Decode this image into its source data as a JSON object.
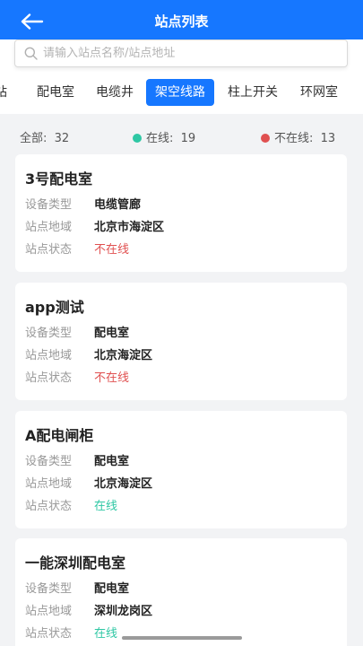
{
  "header": {
    "title": "站点列表"
  },
  "search": {
    "placeholder": "请输入站点名称/站点地址"
  },
  "tabs": [
    {
      "label": "站"
    },
    {
      "label": "配电室"
    },
    {
      "label": "电缆井"
    },
    {
      "label": "架空线路",
      "active": true
    },
    {
      "label": "柱上开关"
    },
    {
      "label": "环网室"
    }
  ],
  "summary": {
    "total_label": "全部:",
    "total": "32",
    "online_label": "在线:",
    "online": "19",
    "offline_label": "不在线:",
    "offline": "13",
    "online_color": "#2ec7a4",
    "offline_color": "#e05050"
  },
  "field_labels": {
    "type": "设备类型",
    "region": "站点地域",
    "status": "站点状态"
  },
  "stations": [
    {
      "name": "3号配电室",
      "type": "电缆管廊",
      "region": "北京市海淀区",
      "status": "不在线"
    },
    {
      "name": "app测试",
      "type": "配电室",
      "region": "北京海淀区",
      "status": "不在线"
    },
    {
      "name": "A配电闸柜",
      "type": "配电室",
      "region": "北京海淀区",
      "status": "在线"
    },
    {
      "name": "一能深圳配电室",
      "type": "配电室",
      "region": "深圳龙岗区",
      "status": "在线"
    }
  ],
  "colors": {
    "accent": "#1677ff"
  }
}
